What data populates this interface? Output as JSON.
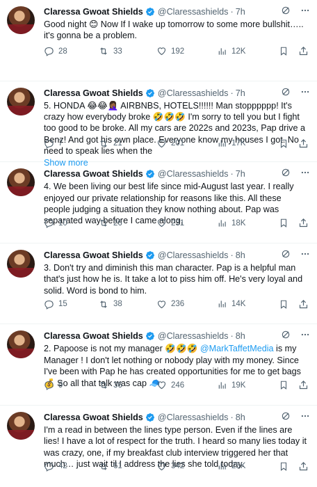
{
  "tweets": [
    {
      "name": "Claressa Gwoat Shields",
      "handle": "@Claressashields",
      "sep": "·",
      "time": "7h",
      "text": "Good night 😊 Now If I wake up tomorrow to some more bullshit….. it's gonna be a problem.",
      "replies": "28",
      "retweets": "33",
      "likes": "192",
      "views": "12K"
    },
    {
      "name": "Claressa Gwoat Shields",
      "handle": "@Claressashields",
      "sep": "·",
      "time": "7h",
      "text": "5. HONDA 😂😂🤦🏾‍♀️ AIRBNBS, HOTELS!!!!!! Man stopppppp! It's crazy how everybody broke 🤣🤣🤣 I'm sorry to tell you but I fight too good to be broke. All my cars are 2022s and 2023s, Pap drive a Benz! And got his own place. Everyone know my houses I got. No need to speak lies when the",
      "show_more": "Show more",
      "replies": "7",
      "retweets": "21",
      "likes": "201",
      "views": "17K"
    },
    {
      "name": "Claressa Gwoat Shields",
      "handle": "@Claressashields",
      "sep": "·",
      "time": "7h",
      "text": "4. We been living our best life since mid-August last year. I really enjoyed our private relationship for reasons like this. All these people judging a situation they know nothing about. Pap was separated way before I came along,",
      "replies": "10",
      "retweets": "26",
      "likes": "231",
      "views": "18K"
    },
    {
      "name": "Claressa Gwoat Shields",
      "handle": "@Claressashields",
      "sep": "·",
      "time": "8h",
      "text": "3. Don't try and diminish this man character. Pap is a helpful man that's just how he is. It take a lot to piss him off. He's very loyal and solid. Word is bond to him.",
      "replies": "15",
      "retweets": "38",
      "likes": "236",
      "views": "14K"
    },
    {
      "name": "Claressa Gwoat Shields",
      "handle": "@Claressashields",
      "sep": "·",
      "time": "8h",
      "text_before": "2. Papoose is not my manager 🤣🤣🤣 ",
      "mention": "@MarkTaffetMedia",
      "text_after": " is my Manager ! I don't let nothing or nobody play with my money. Since I've been with Pap he has created opportunities for me to get bags 💰 So all that talk was cap 🧢",
      "replies": "9",
      "retweets": "36",
      "likes": "246",
      "views": "19K"
    },
    {
      "name": "Claressa Gwoat Shields",
      "handle": "@Claressashields",
      "sep": "·",
      "time": "8h",
      "text": "I'm a read in between the lines type person. Even if the lines are lies! I have a lot of respect for the truth. I heard so many lies today it was crazy, one, if my breakfast club interview triggered her that much… just wait til I address the lies she told today.",
      "replies": "42",
      "retweets": "61",
      "likes": "342",
      "views": "25K"
    }
  ],
  "icons": {
    "verified": "verified-badge-icon",
    "grok": "grok-icon",
    "more": "more-icon",
    "reply": "reply-icon",
    "retweet": "retweet-icon",
    "like": "like-icon",
    "views": "views-icon",
    "bookmark": "bookmark-icon",
    "share": "share-icon"
  },
  "colors": {
    "accent": "#1d9bf0",
    "muted": "#536471",
    "text": "#0f1419"
  }
}
